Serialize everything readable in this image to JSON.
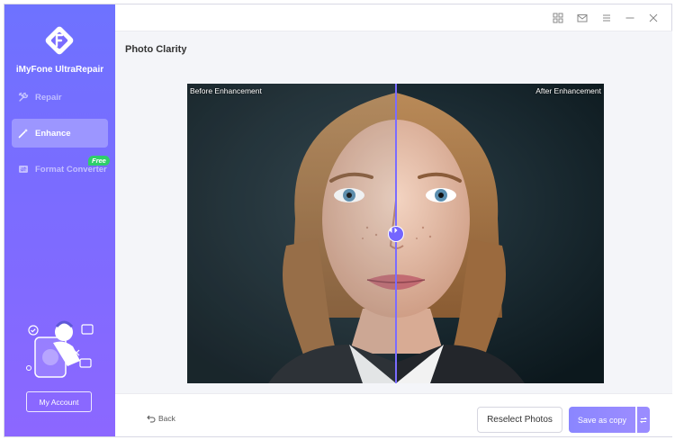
{
  "app": {
    "name": "iMyFone UltraRepair"
  },
  "sidebar": {
    "items": [
      {
        "label": "Repair",
        "icon": "wrench-icon"
      },
      {
        "label": "Enhance",
        "icon": "magic-wand-icon",
        "active": true
      },
      {
        "label": "Format Converter",
        "icon": "convert-icon",
        "badge": "Free"
      }
    ],
    "account_label": "My Account"
  },
  "titlebar": {
    "icons": [
      "grid-icon",
      "mail-icon",
      "menu-icon",
      "minimize-icon",
      "close-icon"
    ]
  },
  "main": {
    "title": "Photo Clarity",
    "compare": {
      "before_label": "Before Enhancement",
      "after_label": "After Enhancement",
      "divider_position": 0.5
    }
  },
  "footer": {
    "back_label": "Back",
    "reselect_label": "Reselect Photos",
    "save_label": "Save as copy"
  },
  "colors": {
    "sidebar_top": "#6e72ff",
    "sidebar_bottom": "#8c67ff",
    "accent": "#7465ff",
    "badge": "#2fcf6a"
  }
}
